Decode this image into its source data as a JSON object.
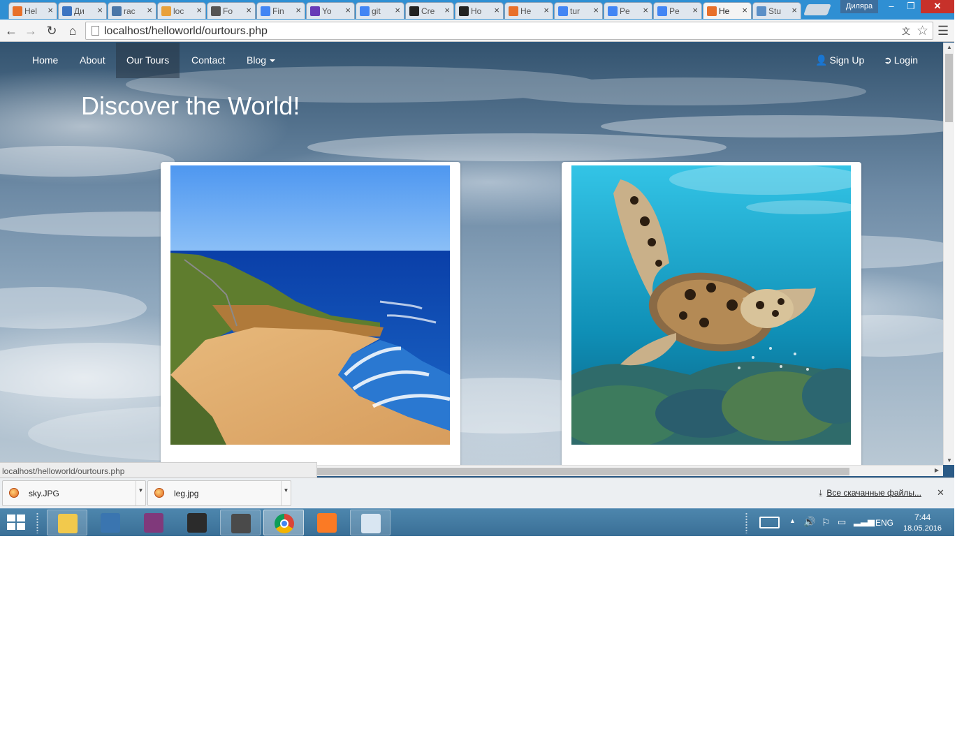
{
  "browser": {
    "tabs": [
      {
        "title": "Hel",
        "icon": "xampp-icon",
        "color": "#e8702a",
        "active": false
      },
      {
        "title": "Ди",
        "icon": "chat-icon",
        "color": "#3b74c2",
        "active": false
      },
      {
        "title": "rac",
        "icon": "vk-icon",
        "color": "#4a76a8",
        "active": false
      },
      {
        "title": "loc",
        "icon": "phpmyadmin-icon",
        "color": "#e9a13b",
        "active": false
      },
      {
        "title": "Fo",
        "icon": "contact-icon",
        "color": "#555555",
        "active": false
      },
      {
        "title": "Fin",
        "icon": "docs-icon",
        "color": "#4285f4",
        "active": false
      },
      {
        "title": "Yo",
        "icon": "forms-icon",
        "color": "#673ab7",
        "active": false
      },
      {
        "title": "git",
        "icon": "google-icon",
        "color": "#4285f4",
        "active": false
      },
      {
        "title": "Cre",
        "icon": "github-icon",
        "color": "#222222",
        "active": false
      },
      {
        "title": "Ho",
        "icon": "github-icon",
        "color": "#222222",
        "active": false
      },
      {
        "title": "He",
        "icon": "xampp-icon",
        "color": "#e8702a",
        "active": false
      },
      {
        "title": "tur",
        "icon": "google-icon",
        "color": "#4285f4",
        "active": false
      },
      {
        "title": "Pe",
        "icon": "google-icon",
        "color": "#4285f4",
        "active": false
      },
      {
        "title": "Pe",
        "icon": "google-icon",
        "color": "#4285f4",
        "active": false
      },
      {
        "title": "He",
        "icon": "xampp-icon",
        "color": "#e8702a",
        "active": true
      },
      {
        "title": "Stu",
        "icon": "stackoverflow-icon",
        "color": "#5a8fc7",
        "active": false
      }
    ],
    "user_name": "Диляра",
    "window_controls": {
      "minimize": "–",
      "maximize": "❐",
      "close": "✕"
    },
    "tab_close_glyph": "×",
    "url": "localhost/helloworld/ourtours.php",
    "status_url": "localhost/helloworld/ourtours.php"
  },
  "site": {
    "nav": {
      "home": "Home",
      "about": "About",
      "tours": "Our Tours",
      "contact": "Contact",
      "blog": "Blog",
      "signup": "Sign Up",
      "login": "Login",
      "active": "Our Tours"
    },
    "heading": "Discover the World!",
    "cards": [
      {
        "image": "beach-cliff-photo"
      },
      {
        "image": "sea-turtle-photo"
      }
    ]
  },
  "downloads": {
    "items": [
      {
        "name": "sky.JPG"
      },
      {
        "name": "leg.jpg"
      }
    ],
    "show_all": "Все скачанные файлы..."
  },
  "taskbar": {
    "apps": [
      {
        "name": "file-explorer-icon",
        "color": "#f2c94c",
        "state": "pinned-open"
      },
      {
        "name": "python-icon",
        "color": "#3a75b0",
        "state": "pinned"
      },
      {
        "name": "onenote-icon",
        "color": "#80397b",
        "state": "pinned"
      },
      {
        "name": "terminal-icon",
        "color": "#2b2b2b",
        "state": "pinned"
      },
      {
        "name": "sublime-text-icon",
        "color": "#4a4a4a",
        "state": "pinned-open"
      },
      {
        "name": "chrome-icon",
        "color": "#db4437",
        "state": "focused"
      },
      {
        "name": "xampp-icon",
        "color": "#fb7a24",
        "state": "pinned"
      },
      {
        "name": "paint-icon",
        "color": "#d9e6f2",
        "state": "pinned-open"
      }
    ],
    "language": "ENG",
    "time": "7:44",
    "date": "18.05.2016"
  }
}
